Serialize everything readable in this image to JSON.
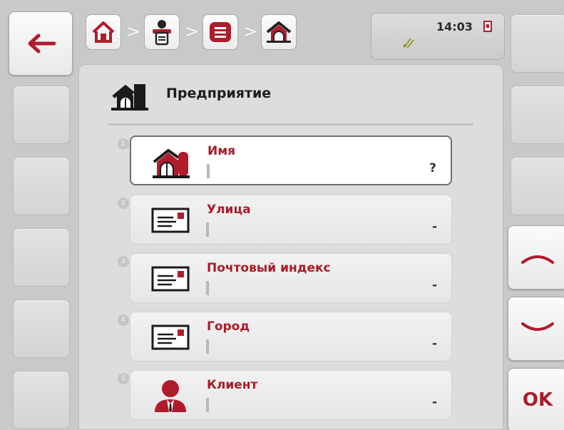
{
  "status": {
    "time": "14:03"
  },
  "breadcrumb": [
    {
      "icon": "home-icon"
    },
    {
      "icon": "farm-data-icon"
    },
    {
      "icon": "list-icon"
    },
    {
      "icon": "enterprise-icon"
    }
  ],
  "header": {
    "title": "Предприятие"
  },
  "fields": [
    {
      "index": "1",
      "label": "Имя",
      "value": "?",
      "icon": "farm-icon"
    },
    {
      "index": "2",
      "label": "Улица",
      "value": "-",
      "icon": "address-card-icon"
    },
    {
      "index": "3",
      "label": "Почтовый индекс",
      "value": "-",
      "icon": "address-card-icon"
    },
    {
      "index": "4",
      "label": "Город",
      "value": "-",
      "icon": "address-card-icon"
    },
    {
      "index": "5",
      "label": "Клиент",
      "value": "-",
      "icon": "customer-icon"
    }
  ],
  "sidebar": {
    "ok_label": "OK"
  },
  "colors": {
    "accent": "#a81c2a",
    "background": "#c9c9c9"
  }
}
